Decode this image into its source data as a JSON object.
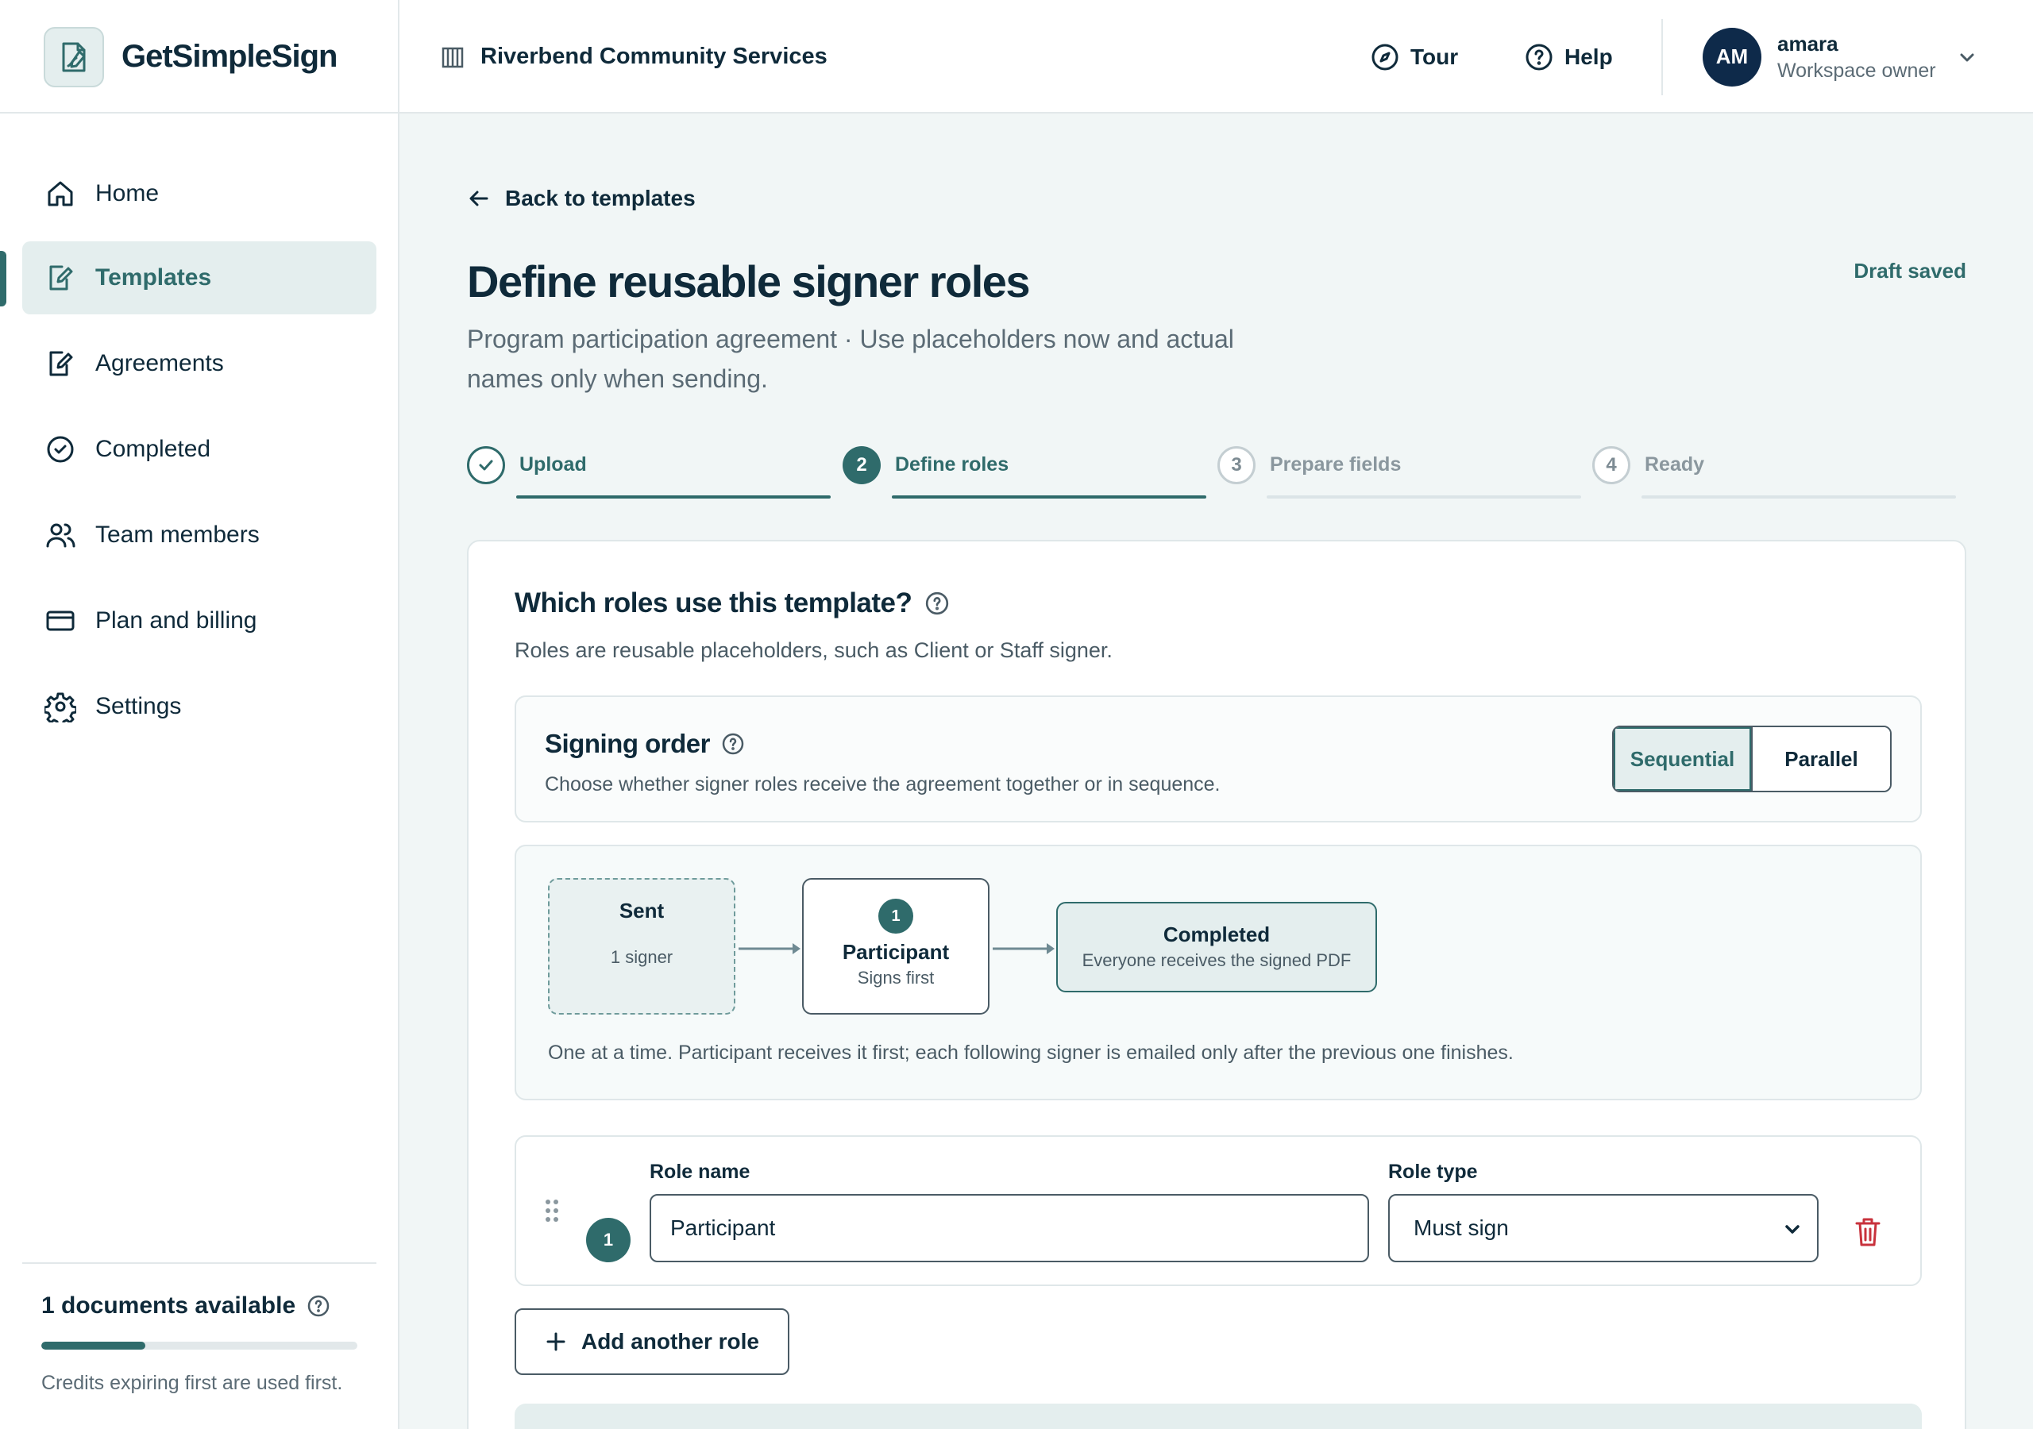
{
  "app": {
    "brand_name": "GetSimpleSign",
    "org_name": "Riverbend Community Services",
    "tour_label": "Tour",
    "help_label": "Help",
    "user": {
      "initials": "AM",
      "name": "amara",
      "role": "Workspace owner"
    }
  },
  "sidebar": {
    "items": [
      {
        "label": "Home",
        "icon": "home-icon",
        "active": false
      },
      {
        "label": "Templates",
        "icon": "template-icon",
        "active": true
      },
      {
        "label": "Agreements",
        "icon": "agreement-icon",
        "active": false
      },
      {
        "label": "Completed",
        "icon": "check-circle-icon",
        "active": false
      },
      {
        "label": "Team members",
        "icon": "users-icon",
        "active": false
      },
      {
        "label": "Plan and billing",
        "icon": "credit-card-icon",
        "active": false
      },
      {
        "label": "Settings",
        "icon": "gear-icon",
        "active": false
      }
    ],
    "credits": {
      "title": "1 documents available",
      "progress": 0.33,
      "note": "Credits expiring first are used first."
    }
  },
  "main": {
    "back_label": "Back to templates",
    "title": "Define reusable signer roles",
    "status": "Draft saved",
    "subtitle": "Program participation agreement · Use placeholders now and actual names only when sending.",
    "steps": [
      {
        "label": "Upload",
        "number": "1",
        "state": "done"
      },
      {
        "label": "Define roles",
        "number": "2",
        "state": "current"
      },
      {
        "label": "Prepare fields",
        "number": "3",
        "state": "todo"
      },
      {
        "label": "Ready",
        "number": "4",
        "state": "todo"
      }
    ],
    "card": {
      "title": "Which roles use this template?",
      "description": "Roles are reusable placeholders, such as Client or Staff signer.",
      "signing_order": {
        "title": "Signing order",
        "description": "Choose whether signer roles receive the agreement together or in sequence.",
        "options": [
          "Sequential",
          "Parallel"
        ],
        "selected": "Sequential"
      },
      "flow": {
        "sent": {
          "title": "Sent",
          "sub": "1 signer"
        },
        "participant": {
          "number": "1",
          "title": "Participant",
          "sub": "Signs first"
        },
        "completed": {
          "title": "Completed",
          "sub": "Everyone receives the signed PDF"
        },
        "note": "One at a time. Participant receives it first; each following signer is emailed only after the previous one finishes."
      },
      "role": {
        "number": "1",
        "name_label": "Role name",
        "name_value": "Participant",
        "type_label": "Role type",
        "type_value": "Must sign"
      },
      "add_role_label": "Add another role"
    }
  },
  "colors": {
    "accent": "#2f6b6b",
    "accent_soft": "#e4eeee",
    "navy": "#0e2a4a",
    "danger": "#c8323c"
  }
}
